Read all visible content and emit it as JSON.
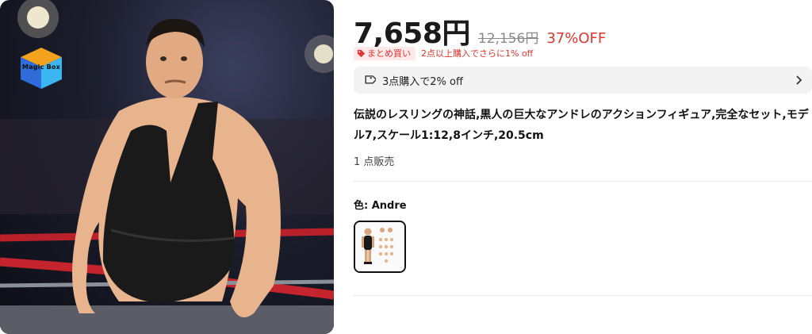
{
  "product_image": {
    "alt": "Andre action figure in black singlet standing in a wrestling ring",
    "brand_logo_text": "Magic Box"
  },
  "price": {
    "current": "7,658円",
    "original": "12,156円",
    "discount": "37%OFF"
  },
  "promo": {
    "tag_label": "まとめ買い",
    "text": "2点以上購入でさらに1% off"
  },
  "coupon": {
    "label": "3点購入で2% off",
    "icon": "tag-icon"
  },
  "product": {
    "title": "伝説のレスリングの神話,黒人の巨大なアンドレのアクションフィギュア,完全なセット,モデル7,スケール1:12,8インチ,20.5cm",
    "sold": "1 点販売"
  },
  "variant": {
    "label": "色: Andre",
    "selected": "Andre"
  },
  "colors": {
    "accent": "#e0342c",
    "promo_bg": "#fde8ea",
    "coupon_bg": "#f3f3f3"
  }
}
